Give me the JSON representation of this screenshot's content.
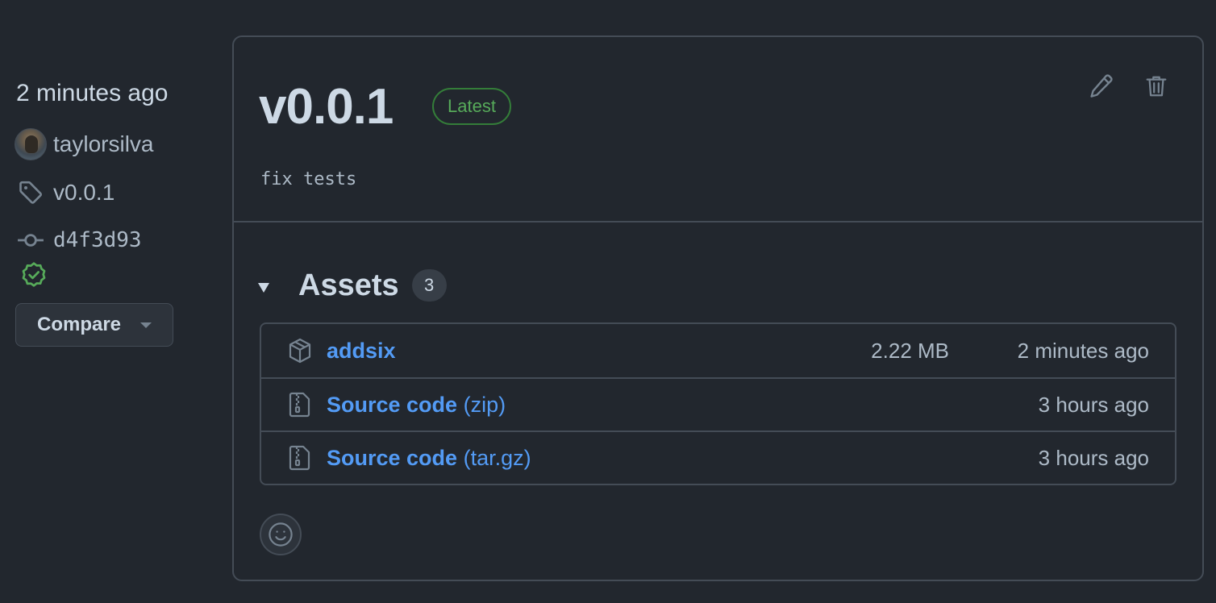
{
  "sidebar": {
    "published": "2 minutes ago",
    "author": "taylorsilva",
    "tag": "v0.0.1",
    "commit": "d4f3d93",
    "compare_label": "Compare"
  },
  "release": {
    "title": "v0.0.1",
    "badge": "Latest",
    "body": "fix tests",
    "assets": {
      "title": "Assets",
      "count": "3",
      "items": [
        {
          "icon": "package-icon",
          "name": "addsix",
          "suffix": "",
          "size": "2.22 MB",
          "time": "2 minutes ago"
        },
        {
          "icon": "file-zip-icon",
          "name": "Source code",
          "suffix": "(zip)",
          "size": "",
          "time": "3 hours ago"
        },
        {
          "icon": "file-zip-icon",
          "name": "Source code",
          "suffix": "(tar.gz)",
          "size": "",
          "time": "3 hours ago"
        }
      ]
    }
  },
  "colors": {
    "background": "#22272e",
    "border": "#444c56",
    "link": "#539bf5",
    "success": "#57ab5a"
  }
}
